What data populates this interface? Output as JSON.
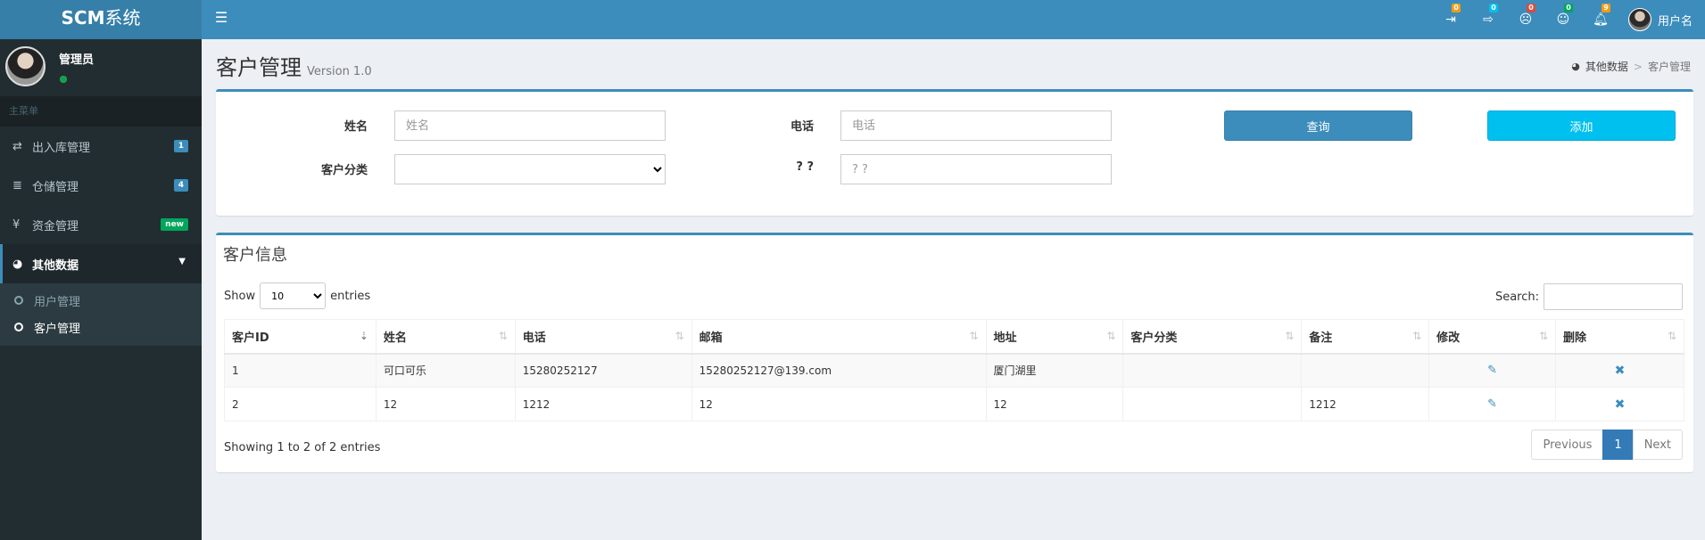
{
  "header": {
    "logo_bold": "SCM",
    "logo_light": "系统",
    "menu_toggle_icon": "hamburger-icon",
    "notifications": [
      {
        "icon": "sign-in-icon",
        "badge": "0",
        "color": "#f39c12"
      },
      {
        "icon": "sign-out-icon",
        "badge": "0",
        "color": "#00c0ef"
      },
      {
        "icon": "frown-icon",
        "badge": "0",
        "color": "#dd4b39"
      },
      {
        "icon": "smile-icon",
        "badge": "0",
        "color": "#00a65a"
      },
      {
        "icon": "bell-icon",
        "badge": "9",
        "color": "#f39c12"
      }
    ],
    "user_name": "用户名"
  },
  "sidebar": {
    "user_name": "管理员",
    "menu_header": "主菜单",
    "items": [
      {
        "label": "出入库管理",
        "icon": "exchange-icon",
        "badge": "1",
        "badge_color": "#3c8dbc"
      },
      {
        "label": "仓储管理",
        "icon": "database-icon",
        "badge": "4",
        "badge_color": "#3c8dbc"
      },
      {
        "label": "资金管理",
        "icon": "yen-icon",
        "badge": "new",
        "badge_color": "#00a65a"
      },
      {
        "label": "其他数据",
        "icon": "pie-chart-icon"
      }
    ],
    "submenu": [
      {
        "label": "用户管理"
      },
      {
        "label": "客户管理"
      }
    ]
  },
  "page": {
    "title": "客户管理",
    "version": "Version 1.0",
    "breadcrumb": [
      "其他数据",
      "客户管理"
    ]
  },
  "filter": {
    "name_label": "姓名",
    "name_placeholder": "姓名",
    "phone_label": "电话",
    "phone_placeholder": "电话",
    "category_label": "客户分类",
    "category_value": "",
    "extra_label": "? ?",
    "extra_placeholder": "? ?",
    "query_button": "查询",
    "add_button": "添加"
  },
  "table_box": {
    "title": "客户信息",
    "show_label": "Show",
    "entries_label": "entries",
    "page_length": "10",
    "search_label": "Search:",
    "columns": [
      "客户ID",
      "姓名",
      "电话",
      "邮箱",
      "地址",
      "客户分类",
      "备注",
      "修改",
      "删除"
    ],
    "rows": [
      {
        "id": "1",
        "name": "可口可乐",
        "phone": "15280252127",
        "email": "15280252127@139.com",
        "address": "厦门湖里",
        "category": "",
        "remark": ""
      },
      {
        "id": "2",
        "name": "12",
        "phone": "1212",
        "email": "12",
        "address": "12",
        "category": "",
        "remark": "1212"
      }
    ],
    "info": "Showing 1 to 2 of 2 entries",
    "pagination": {
      "previous": "Previous",
      "current": "1",
      "next": "Next"
    }
  }
}
